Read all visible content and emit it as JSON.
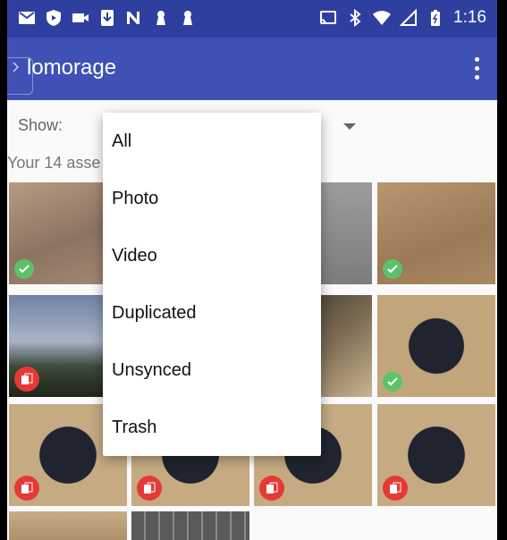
{
  "status_bar": {
    "time": "1:16",
    "left_icons": [
      "gmail-icon",
      "shield-icon",
      "video-camera-icon",
      "download-icon",
      "n-app-icon",
      "keyhole-icon",
      "keyhole-icon"
    ],
    "right_icons": [
      "cast-icon",
      "bluetooth-icon",
      "wifi-icon",
      "signal-icon",
      "battery-icon"
    ]
  },
  "app_bar": {
    "title": "lomorage",
    "menu_icon": "more-vert-icon"
  },
  "filter": {
    "show_label": "Show:",
    "count_text": "Your 14 asse"
  },
  "dropdown": {
    "items": [
      "All",
      "Photo",
      "Video",
      "Duplicated",
      "Unsynced",
      "Trash"
    ]
  },
  "colors": {
    "primary": "#3f51b5",
    "primary_dark": "#2f3fa0",
    "synced": "#5cc26a",
    "duplicate": "#e53935"
  }
}
